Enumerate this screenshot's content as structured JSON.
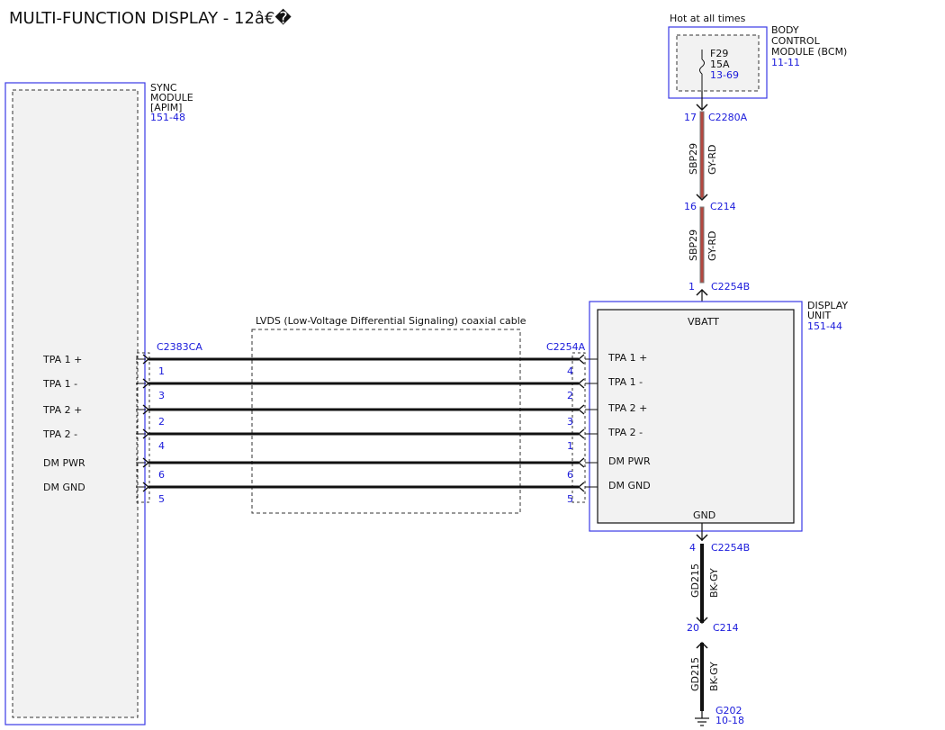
{
  "title": "MULTI-FUNCTION DISPLAY - 12â€�",
  "bcm": {
    "hot_label": "Hot at all times",
    "name_lines": [
      "BODY",
      "CONTROL",
      "MODULE (BCM)"
    ],
    "ref": "11-11",
    "fuse_name": "F29",
    "fuse_rating": "15A",
    "fuse_ref": "13-69"
  },
  "sync": {
    "name_lines": [
      "SYNC",
      "MODULE",
      "[APIM]"
    ],
    "ref": "151-48",
    "connector": "C2383CA"
  },
  "display": {
    "name_lines": [
      "DISPLAY",
      "UNIT"
    ],
    "ref": "151-44",
    "connector": "C2254A",
    "vbatt": "VBATT",
    "gnd": "GND"
  },
  "cable_label": "LVDS (Low-Voltage Differential Signaling) coaxial cable",
  "signals": [
    {
      "left_label": "TPA 1 +",
      "left_pin": "1",
      "right_pin": "4",
      "right_label": "TPA 1 +"
    },
    {
      "left_label": "TPA 1 -",
      "left_pin": "3",
      "right_pin": "2",
      "right_label": "TPA 1 -"
    },
    {
      "left_label": "TPA 2 +",
      "left_pin": "2",
      "right_pin": "3",
      "right_label": "TPA 2 +"
    },
    {
      "left_label": "TPA 2 -",
      "left_pin": "4",
      "right_pin": "1",
      "right_label": "TPA 2 -"
    },
    {
      "left_label": "DM PWR",
      "left_pin": "6",
      "right_pin": "6",
      "right_label": "DM PWR"
    },
    {
      "left_label": "DM GND",
      "left_pin": "5",
      "right_pin": "5",
      "right_label": "DM GND"
    }
  ],
  "power_path": {
    "pin1": "17",
    "conn1": "C2280A",
    "circuit1": "SBP29",
    "color1": "GY-RD",
    "pin2": "16",
    "conn2": "C214",
    "circuit2": "SBP29",
    "color2": "GY-RD",
    "pin3": "1",
    "conn3": "C2254B"
  },
  "ground_path": {
    "pin1": "4",
    "conn1": "C2254B",
    "circuit1": "GD215",
    "color1": "BK-GY",
    "pin2": "20",
    "conn2": "C214",
    "circuit2": "GD215",
    "color2": "BK-GY",
    "ground_id": "G202",
    "ground_ref": "10-18"
  },
  "colors": {
    "module_border": "#3a3ae6",
    "module_fill": "#f2f2f2",
    "ref_text": "#1a1adb",
    "wire_gy_rd_outer": "#8c8c8c",
    "wire_gy_rd_inner": "#b3473f",
    "wire_bk_gy": "#111111"
  }
}
